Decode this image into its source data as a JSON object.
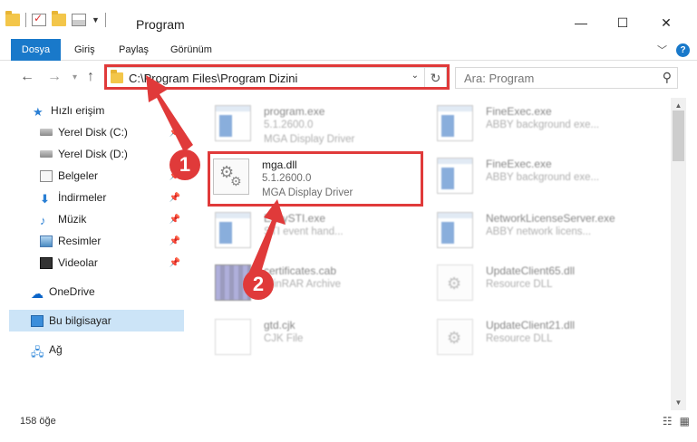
{
  "window": {
    "title": "Program",
    "minimize_glyph": "—",
    "maximize_glyph": "☐",
    "close_glyph": "✕"
  },
  "ribbon": {
    "tabs": [
      "Dosya",
      "Giriş",
      "Paylaş",
      "Görünüm"
    ],
    "help_glyph": "?",
    "expand_glyph": "﹀",
    "active_color": "#1979ca"
  },
  "nav": {
    "back_glyph": "←",
    "forward_glyph": "→",
    "up_glyph": "↑",
    "recent_glyph": "▾",
    "address": "C:\\Program Files\\Program Dizini",
    "address_dropdown_glyph": "⌄",
    "refresh_glyph": "↻",
    "search_placeholder": "Ara: Program",
    "search_glyph": "⚲"
  },
  "sidebar": {
    "items": [
      {
        "label": "Hızlı erişim",
        "icon": "star-icon"
      },
      {
        "label": "Yerel Disk (C:)",
        "icon": "disk-icon"
      },
      {
        "label": "Yerel Disk (D:)",
        "icon": "disk-icon"
      },
      {
        "label": "Belgeler",
        "icon": "documents-icon"
      },
      {
        "label": "İndirmeler",
        "icon": "download-icon"
      },
      {
        "label": "Müzik",
        "icon": "music-icon"
      },
      {
        "label": "Resimler",
        "icon": "pictures-icon"
      },
      {
        "label": "Videolar",
        "icon": "video-icon"
      },
      {
        "label": "OneDrive",
        "icon": "cloud-icon"
      },
      {
        "label": "Bu bilgisayar",
        "icon": "computer-icon"
      },
      {
        "label": "Ağ",
        "icon": "network-icon"
      }
    ],
    "pin_glyph": "📌"
  },
  "files": [
    {
      "name": "program.exe",
      "line1": "5.1.2600.0",
      "line2": "MGA Display Driver",
      "icon": "exe-icon"
    },
    {
      "name": "FineExec.exe",
      "line1": "ABBY background exe...",
      "line2": "",
      "icon": "exe-icon"
    },
    {
      "name": "mga.dll",
      "line1": "5.1.2600.0",
      "line2": "MGA Display Driver",
      "icon": "dll-icon"
    },
    {
      "name": "FineExec.exe",
      "line1": "ABBY background exe...",
      "line2": "",
      "icon": "exe-icon"
    },
    {
      "name": "EasySTI.exe",
      "line1": "STI event hand...",
      "line2": "",
      "icon": "exe-icon"
    },
    {
      "name": "NetworkLicenseServer.exe",
      "line1": "ABBY network licens...",
      "line2": "",
      "icon": "exe-icon"
    },
    {
      "name": "certificates.cab",
      "line1": "WinRAR Archive",
      "line2": "",
      "icon": "archive-icon"
    },
    {
      "name": "UpdateClient65.dll",
      "line1": "Resource DLL",
      "line2": "",
      "icon": "dll-icon"
    },
    {
      "name": "gtd.cjk",
      "line1": "CJK File",
      "line2": "",
      "icon": "file-icon"
    },
    {
      "name": "UpdateClient21.dll",
      "line1": "Resource DLL",
      "line2": "",
      "icon": "dll-icon"
    }
  ],
  "status": {
    "item_count": "158 öğe",
    "details_view_glyph": "☷",
    "tiles_view_glyph": "▦"
  },
  "annotations": {
    "badge1": "1",
    "badge2": "2",
    "color": "#e03a3a"
  }
}
